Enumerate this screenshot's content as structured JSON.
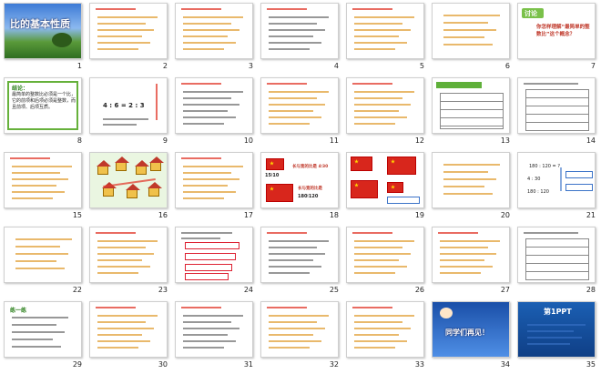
{
  "slides": [
    {
      "number": "1",
      "title": "比的基本性质",
      "kind": "cover"
    },
    {
      "number": "2",
      "kind": "text"
    },
    {
      "number": "3",
      "kind": "text"
    },
    {
      "number": "4",
      "kind": "text"
    },
    {
      "number": "5",
      "kind": "text"
    },
    {
      "number": "6",
      "kind": "text-center"
    },
    {
      "number": "7",
      "kind": "discuss",
      "badge": "讨论",
      "question": "你怎样理解“最简单的整数比”这个概念？"
    },
    {
      "number": "8",
      "kind": "green",
      "heading": "结论：",
      "text": "最简单的整数比必须是一个比，它的前项和后项必须是整数，而且前项、后项互质。"
    },
    {
      "number": "9",
      "kind": "ratio",
      "formula": "4 : 6   =   2 : 3"
    },
    {
      "number": "10",
      "kind": "text"
    },
    {
      "number": "11",
      "kind": "text"
    },
    {
      "number": "12",
      "kind": "text"
    },
    {
      "number": "13",
      "kind": "table-green"
    },
    {
      "number": "14",
      "kind": "table"
    },
    {
      "number": "15",
      "kind": "text"
    },
    {
      "number": "16",
      "kind": "houses"
    },
    {
      "number": "17",
      "kind": "text"
    },
    {
      "number": "18",
      "kind": "flags",
      "ratio1": "长与宽的比是 4∶30",
      "ratio2": "15∶10",
      "ratio3": "长与宽的比是",
      "ratio4": "180∶120"
    },
    {
      "number": "19",
      "kind": "flags2"
    },
    {
      "number": "20",
      "kind": "text-center"
    },
    {
      "number": "21",
      "kind": "ratios",
      "r1": "180 : 120 = ?",
      "r2": "4 : 30",
      "r3": "180 : 120"
    },
    {
      "number": "22",
      "kind": "text-center"
    },
    {
      "number": "23",
      "kind": "text"
    },
    {
      "number": "24",
      "kind": "boxes"
    },
    {
      "number": "25",
      "kind": "text"
    },
    {
      "number": "26",
      "kind": "text"
    },
    {
      "number": "27",
      "kind": "text"
    },
    {
      "number": "28",
      "kind": "table"
    },
    {
      "number": "29",
      "kind": "practice",
      "heading": "练一练"
    },
    {
      "number": "30",
      "kind": "text"
    },
    {
      "number": "31",
      "kind": "text"
    },
    {
      "number": "32",
      "kind": "text"
    },
    {
      "number": "33",
      "kind": "text"
    },
    {
      "number": "34",
      "kind": "goodbye",
      "text": "同学们再见！"
    },
    {
      "number": "35",
      "kind": "brand",
      "text": "第1PPT"
    }
  ]
}
